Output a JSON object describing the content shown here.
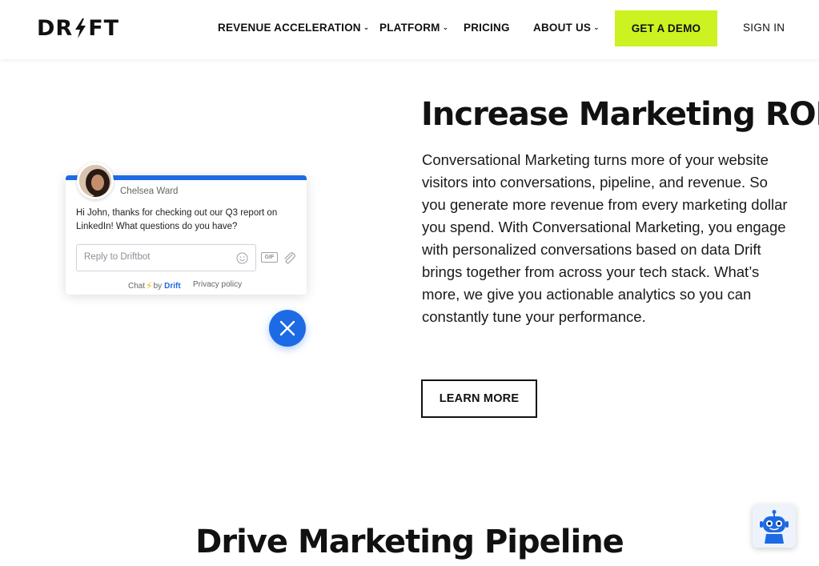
{
  "brand": {
    "logo_text_left": "DR",
    "logo_text_right": "FT"
  },
  "nav": {
    "items": [
      {
        "label": "REVENUE ACCELERATION",
        "has_dropdown": true
      },
      {
        "label": "PLATFORM",
        "has_dropdown": true
      },
      {
        "label": "PRICING",
        "has_dropdown": false
      },
      {
        "label": "ABOUT US",
        "has_dropdown": true
      }
    ],
    "demo_label": "GET A DEMO",
    "signin_label": "SIGN IN"
  },
  "chat_widget": {
    "agent_name": "Chelsea Ward",
    "message": "Hi John, thanks for checking out our Q3 report on LinkedIn! What questions do you have?",
    "reply_placeholder": "Reply to Driftbot",
    "gif_label": "GIF",
    "powered_prefix": "Chat",
    "powered_by": "by",
    "powered_brand": "Drift",
    "privacy_label": "Privacy policy"
  },
  "hero": {
    "title": "Increase Marketing ROI",
    "body": "Conversational Marketing turns more of your website visitors into conversations, pipeline, and revenue. So you generate more revenue from every marketing dollar you spend. With Conversational Marketing, you engage with personalized conversations based on data Drift brings together from across your tech stack. What’s more, we give you actionable analytics so you can constantly tune your performance.",
    "cta_label": "LEARN MORE"
  },
  "section2": {
    "title": "Drive Marketing Pipeline"
  },
  "colors": {
    "accent_green": "#cdf221",
    "drift_blue": "#1d6ae5",
    "text": "#111111"
  }
}
